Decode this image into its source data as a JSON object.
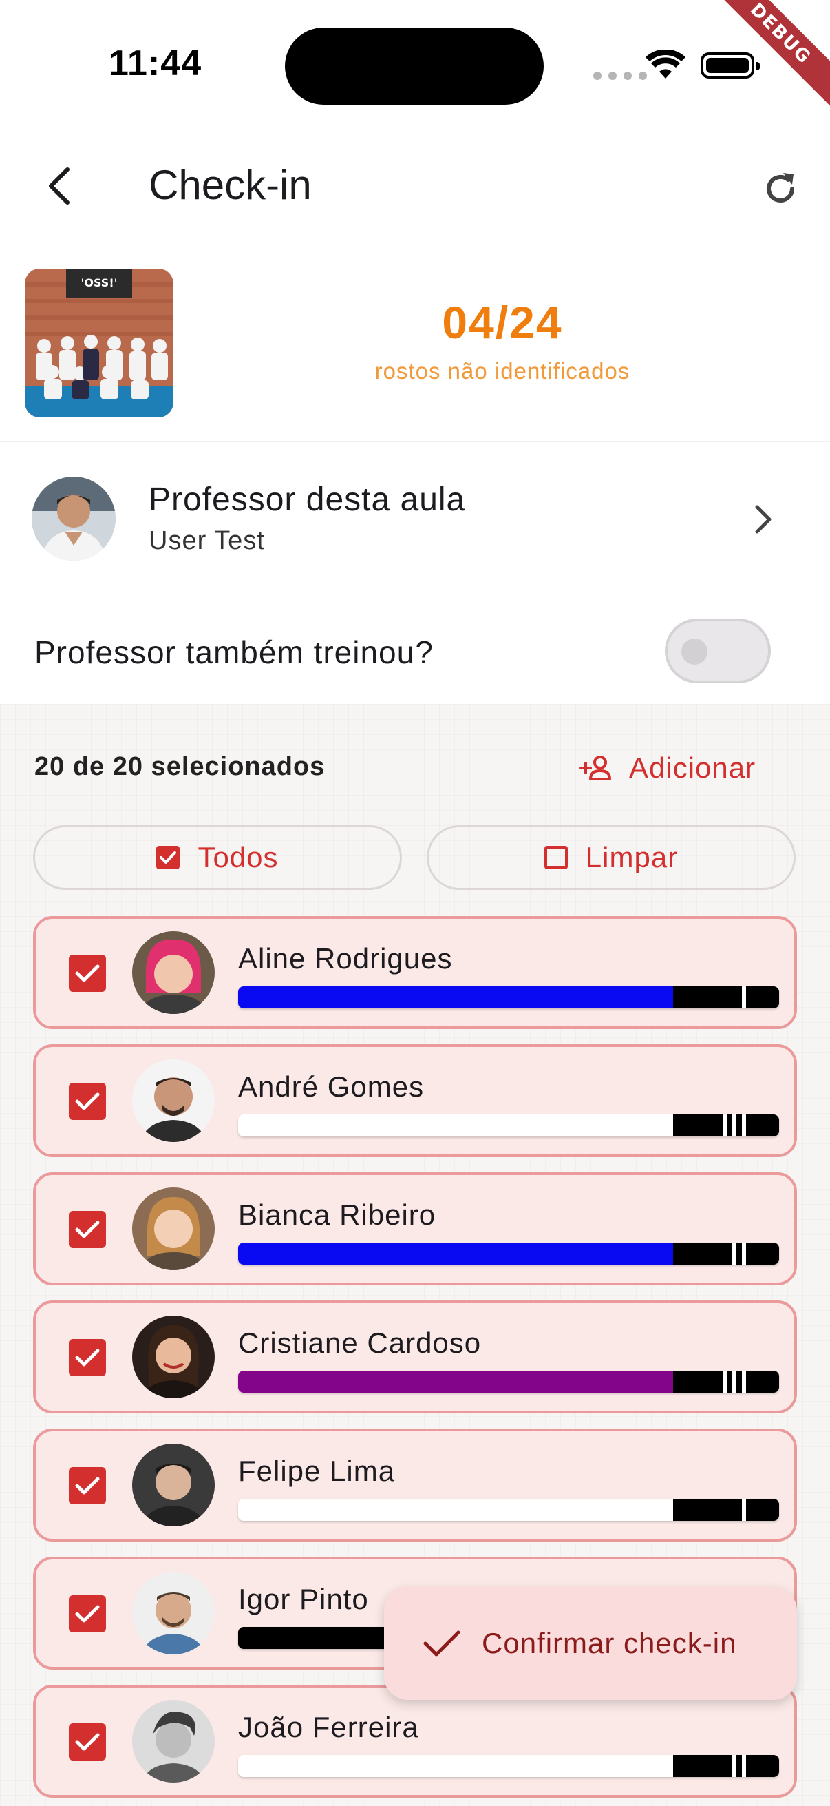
{
  "status_bar": {
    "time": "11:44",
    "debug_label": "DEBUG"
  },
  "header": {
    "title": "Check-in",
    "back_icon": "chevron-left-icon",
    "refresh_icon": "refresh-icon"
  },
  "summary": {
    "counter": "04/24",
    "counter_label": "rostos não identificados",
    "photo_banner": "'OSS!'"
  },
  "professor": {
    "title": "Professor desta aula",
    "name": "User Test",
    "trained_label": "Professor também treinou?",
    "trained": false
  },
  "selection": {
    "count_text": "20 de 20 selecionados",
    "add_label": "Adicionar",
    "all_label": "Todos",
    "clear_label": "Limpar"
  },
  "students": [
    {
      "name": "Aline Rodrigues",
      "belt_color": "#0a0af2",
      "stripes": 1,
      "checked": true
    },
    {
      "name": "André Gomes",
      "belt_color": "#ffffff",
      "stripes": 3,
      "checked": true
    },
    {
      "name": "Bianca Ribeiro",
      "belt_color": "#0a0af2",
      "stripes": 2,
      "checked": true
    },
    {
      "name": "Cristiane Cardoso",
      "belt_color": "#82058a",
      "stripes": 3,
      "checked": true
    },
    {
      "name": "Felipe Lima",
      "belt_color": "#ffffff",
      "stripes": 1,
      "checked": true
    },
    {
      "name": "Igor Pinto",
      "belt_color": "#000000",
      "stripes": 1,
      "checked": true
    },
    {
      "name": "João Ferreira",
      "belt_color": "#ffffff",
      "stripes": 2,
      "checked": true
    }
  ],
  "fab": {
    "label": "Confirmar check-in"
  },
  "colors": {
    "accent": "#d32f2f",
    "counter": "#ef7e0f"
  }
}
